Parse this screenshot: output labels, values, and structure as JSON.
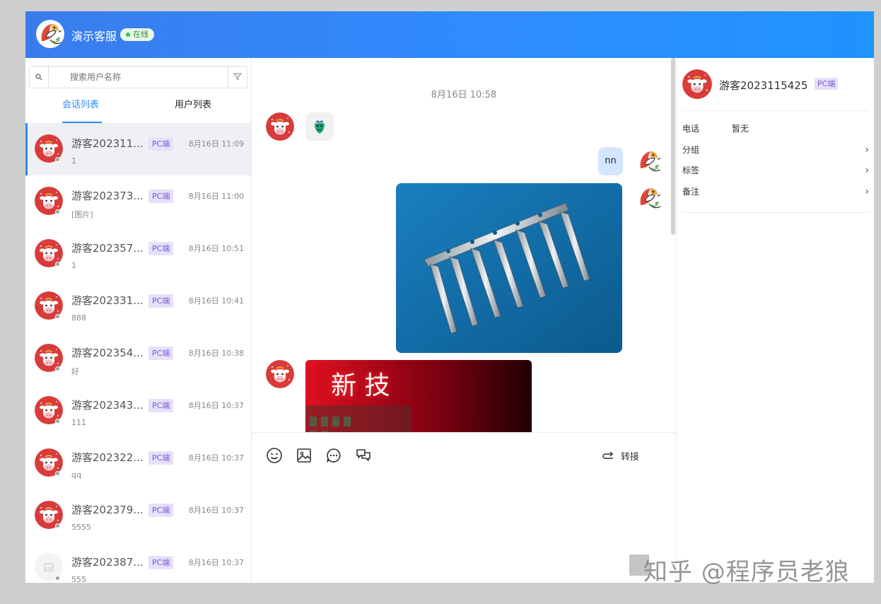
{
  "header": {
    "title": "演示客服",
    "status": "在线"
  },
  "sidebar": {
    "search": {
      "placeholder": "搜索用户名称"
    },
    "tabs": [
      {
        "label": "会话列表",
        "active": true
      },
      {
        "label": "用户列表",
        "active": false
      }
    ],
    "sessions": [
      {
        "name": "游客202311...",
        "badge": "PC端",
        "time": "8月16日 11:09",
        "preview": "1",
        "active": true
      },
      {
        "name": "游客202373...",
        "badge": "PC端",
        "time": "8月16日 11:00",
        "preview": "[图片]",
        "active": false
      },
      {
        "name": "游客202357...",
        "badge": "PC端",
        "time": "8月16日 10:51",
        "preview": "1",
        "active": false
      },
      {
        "name": "游客202331...",
        "badge": "PC端",
        "time": "8月16日 10:41",
        "preview": "888",
        "active": false
      },
      {
        "name": "游客202354...",
        "badge": "PC端",
        "time": "8月16日 10:38",
        "preview": "好",
        "active": false
      },
      {
        "name": "游客202343...",
        "badge": "PC端",
        "time": "8月16日 10:37",
        "preview": "111",
        "active": false
      },
      {
        "name": "游客202322...",
        "badge": "PC端",
        "time": "8月16日 10:37",
        "preview": "qq",
        "active": false
      },
      {
        "name": "游客202379...",
        "badge": "PC端",
        "time": "8月16日 10:37",
        "preview": "5555",
        "active": false
      },
      {
        "name": "游客202387...",
        "badge": "PC端",
        "time": "8月16日 10:37",
        "preview": "555",
        "active": false
      }
    ]
  },
  "chat": {
    "date": "8月16日 10:58",
    "agent_text_message": "nn",
    "image2_text": "新 技",
    "toolbar": {
      "transfer_label": "转接"
    }
  },
  "info": {
    "username": "游客2023115425",
    "badge": "PC端",
    "phone_label": "电话",
    "phone_value": "暂无",
    "group_label": "分组",
    "tag_label": "标签",
    "note_label": "备注"
  },
  "watermark": "知乎 @程序员老狼",
  "colors": {
    "header_start": "#3a7cec",
    "header_end": "#1f93ff",
    "accent": "#2e8cf0",
    "badge_bg": "#e6e0fa",
    "badge_text": "#7a5bd6",
    "online": "#33c24d"
  }
}
